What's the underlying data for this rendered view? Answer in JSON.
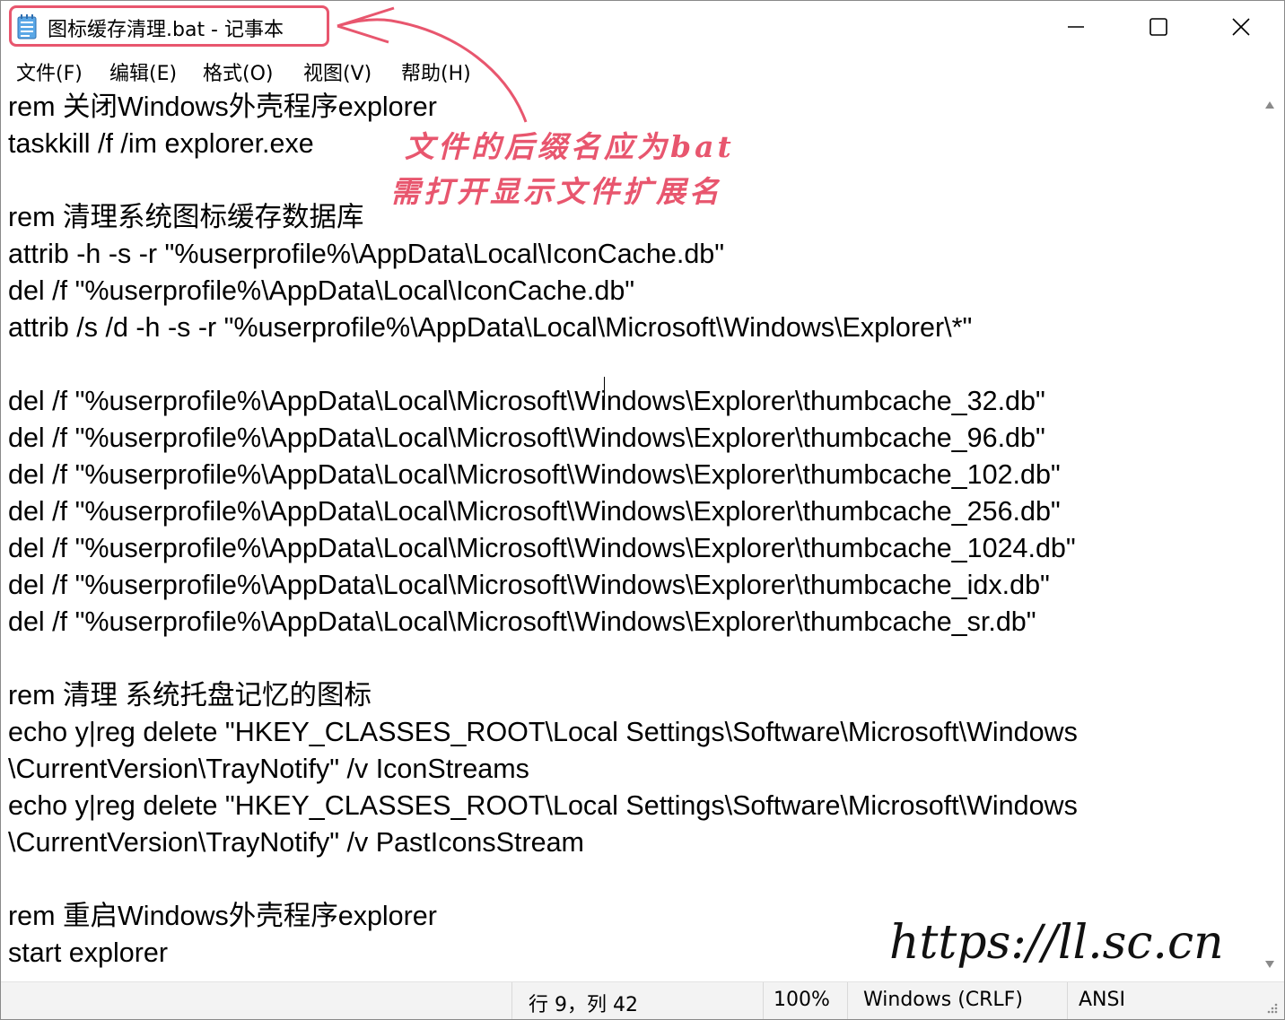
{
  "window": {
    "title": "图标缓存清理.bat - 记事本",
    "controls": {
      "minimize": "minimize",
      "maximize": "maximize",
      "close": "close"
    }
  },
  "menu": {
    "file": "文件(F)",
    "edit": "编辑(E)",
    "format": "格式(O)",
    "view": "视图(V)",
    "help": "帮助(H)"
  },
  "editor": {
    "lines": [
      "rem 关闭Windows外壳程序explorer",
      "taskkill /f /im explorer.exe",
      "",
      "rem 清理系统图标缓存数据库",
      "attrib -h -s -r \"%userprofile%\\AppData\\Local\\IconCache.db\"",
      "del /f \"%userprofile%\\AppData\\Local\\IconCache.db\"",
      "attrib /s /d -h -s -r \"%userprofile%\\AppData\\Local\\Microsoft\\Windows\\Explorer\\*\"",
      "",
      "del /f \"%userprofile%\\AppData\\Local\\Microsoft\\Windows\\Explorer\\thumbcache_32.db\"",
      "del /f \"%userprofile%\\AppData\\Local\\Microsoft\\Windows\\Explorer\\thumbcache_96.db\"",
      "del /f \"%userprofile%\\AppData\\Local\\Microsoft\\Windows\\Explorer\\thumbcache_102.db\"",
      "del /f \"%userprofile%\\AppData\\Local\\Microsoft\\Windows\\Explorer\\thumbcache_256.db\"",
      "del /f \"%userprofile%\\AppData\\Local\\Microsoft\\Windows\\Explorer\\thumbcache_1024.db\"",
      "del /f \"%userprofile%\\AppData\\Local\\Microsoft\\Windows\\Explorer\\thumbcache_idx.db\"",
      "del /f \"%userprofile%\\AppData\\Local\\Microsoft\\Windows\\Explorer\\thumbcache_sr.db\"",
      "",
      "rem 清理 系统托盘记忆的图标",
      "echo y|reg delete \"HKEY_CLASSES_ROOT\\Local Settings\\Software\\Microsoft\\Windows",
      "\\CurrentVersion\\TrayNotify\" /v IconStreams",
      "echo y|reg delete \"HKEY_CLASSES_ROOT\\Local Settings\\Software\\Microsoft\\Windows",
      "\\CurrentVersion\\TrayNotify\" /v PastIconsStream",
      "",
      "rem 重启Windows外壳程序explorer",
      "start explorer"
    ]
  },
  "status": {
    "position": "行 9，列 42",
    "zoom": "100%",
    "line_ending": "Windows (CRLF)",
    "encoding": "ANSI"
  },
  "annotation": {
    "line1": "文件的后缀名应为bat",
    "line2": "需打开显示文件扩展名",
    "color": "#e8566e"
  },
  "watermark": "https://ll.sc.cn"
}
